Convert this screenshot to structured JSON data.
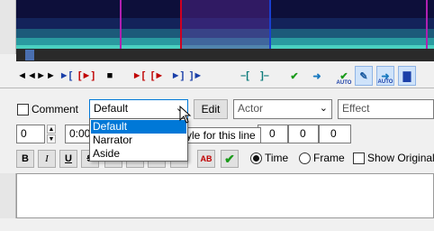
{
  "toolbar": {
    "buttons": [
      {
        "name": "prev-line-button",
        "glyph": "◄◄",
        "color": "#000000",
        "active": false
      },
      {
        "name": "next-line-button",
        "glyph": "►►",
        "color": "#000000",
        "active": false
      },
      {
        "name": "play-selection-button",
        "glyph": "►[",
        "color": "#1a3fa8",
        "active": false
      },
      {
        "name": "play-line-button",
        "glyph": "[►]",
        "color": "#c00000",
        "active": false
      },
      {
        "name": "stop-button",
        "glyph": "■",
        "color": "#000000",
        "active": false
      },
      {
        "name": "play-before-button",
        "glyph": "►[",
        "color": "#c00000",
        "active": false
      },
      {
        "name": "play-after-start-button",
        "glyph": "[►",
        "color": "#c00000",
        "active": false
      },
      {
        "name": "play-before-end-button",
        "glyph": "►]",
        "color": "#1a3fa8",
        "active": false
      },
      {
        "name": "play-after-button",
        "glyph": "]►",
        "color": "#1a3fa8",
        "active": false
      },
      {
        "name": "lead-in-button",
        "glyph": "–[",
        "color": "#0a7a7a",
        "active": false
      },
      {
        "name": "lead-out-button",
        "glyph": "]–",
        "color": "#0a7a7a",
        "active": false
      },
      {
        "name": "commit-button",
        "glyph": "✔",
        "color": "#1a9a1a",
        "active": false
      },
      {
        "name": "go-to-next-button",
        "glyph": "➜",
        "color": "#1a7ac0",
        "active": false
      },
      {
        "name": "auto-commit-button",
        "glyph": "✔",
        "color": "#1a9a1a",
        "active": false,
        "auto": "AUTO"
      },
      {
        "name": "next-line-on-commit-button",
        "glyph": "✎",
        "color": "#1a5aa0",
        "active": true
      },
      {
        "name": "auto-scroll-button",
        "glyph": "➜",
        "color": "#1a7ac0",
        "active": true,
        "auto": "AUTO"
      },
      {
        "name": "spectrum-mode-button",
        "glyph": "▇",
        "color": "#1a3fa8",
        "active": true
      }
    ]
  },
  "editor": {
    "comment_label": "Comment",
    "style_combo_value": "Default",
    "style_options": [
      "Default",
      "Narrator",
      "Aside"
    ],
    "selected_style": "Default",
    "edit_button": "Edit",
    "actor_placeholder": "Actor",
    "effect_placeholder": "Effect",
    "tooltip_text": "yle for this line",
    "layer_value": "0",
    "start_time_value": "0:00",
    "margin_left": "0",
    "margin_right": "0",
    "margin_vertical": "0"
  },
  "style_buttons": {
    "bold": "B",
    "italic": "I",
    "underline": "U",
    "strikeout": "S",
    "font": "fn",
    "color1": "AB",
    "color2": "AB",
    "color3": "AB",
    "color4": "AB",
    "commit": "✔"
  },
  "mode": {
    "time_label": "Time",
    "frame_label": "Frame",
    "selected": "Time",
    "show_original_label": "Show Original"
  },
  "colors": {
    "selection_blue": "#0078d7",
    "marker_red": "#d00020",
    "marker_magenta": "#b020b0"
  }
}
